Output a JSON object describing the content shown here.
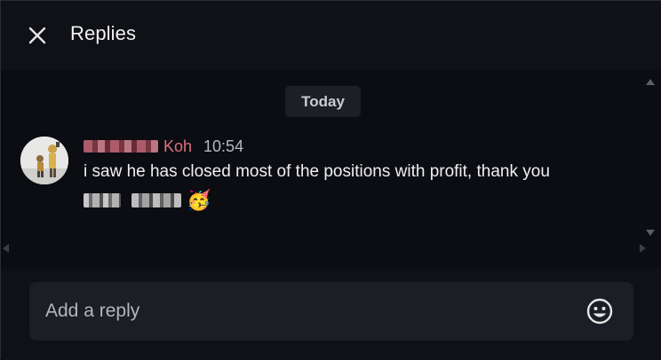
{
  "header": {
    "title": "Replies",
    "close_icon": "close-icon"
  },
  "thread": {
    "date_divider": "Today",
    "message": {
      "author_name": "Koh",
      "author_name_redacted": true,
      "time": "10:54",
      "text": "i saw he has closed most of the positions with profit, thank you",
      "second_line_redacted": true,
      "emoji": "🥳",
      "author_color": "#e0707e"
    }
  },
  "composer": {
    "placeholder": "Add a reply",
    "value": "",
    "emoji_icon": "smiley-icon"
  }
}
